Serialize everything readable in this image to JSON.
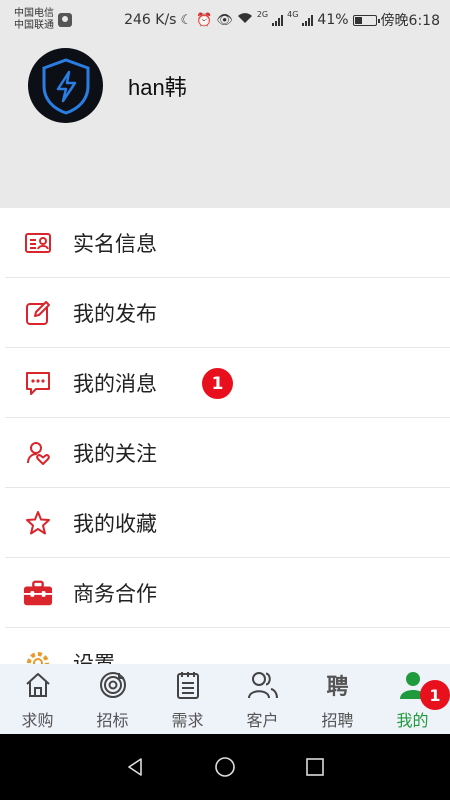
{
  "status_bar": {
    "carrier_1": "中国电信",
    "carrier_2": "中国联通",
    "speed": "246 K/s",
    "network_1": "2G",
    "network_2": "4G",
    "battery": "41%",
    "time": "傍晚6:18",
    "battery_level": 0.41
  },
  "profile": {
    "username": "han韩",
    "avatar_icon": "lightning-shield-icon"
  },
  "menu": {
    "items": [
      {
        "label": "实名信息",
        "icon": "id-card-icon"
      },
      {
        "label": "我的发布",
        "icon": "edit-icon"
      },
      {
        "label": "我的消息",
        "icon": "message-icon",
        "badge": "1"
      },
      {
        "label": "我的关注",
        "icon": "user-heart-icon"
      },
      {
        "label": "我的收藏",
        "icon": "star-icon"
      },
      {
        "label": "商务合作",
        "icon": "briefcase-icon"
      },
      {
        "label": "设置",
        "icon": "gear-icon"
      }
    ]
  },
  "tabbar": {
    "tabs": [
      {
        "label": "求购",
        "icon": "home-icon"
      },
      {
        "label": "招标",
        "icon": "target-icon"
      },
      {
        "label": "需求",
        "icon": "clipboard-icon"
      },
      {
        "label": "客户",
        "icon": "users-icon"
      },
      {
        "label": "招聘",
        "icon": "recruit-icon",
        "icon_text": "聘"
      },
      {
        "label": "我的",
        "icon": "user-icon",
        "badge": "1",
        "active": true
      }
    ]
  },
  "colors": {
    "accent_red": "#d9252b",
    "badge_red": "#e8101c",
    "active_green": "#1f9a3d",
    "header_gray": "#e9e9e9",
    "tabbar_bg": "#eef2f9"
  }
}
